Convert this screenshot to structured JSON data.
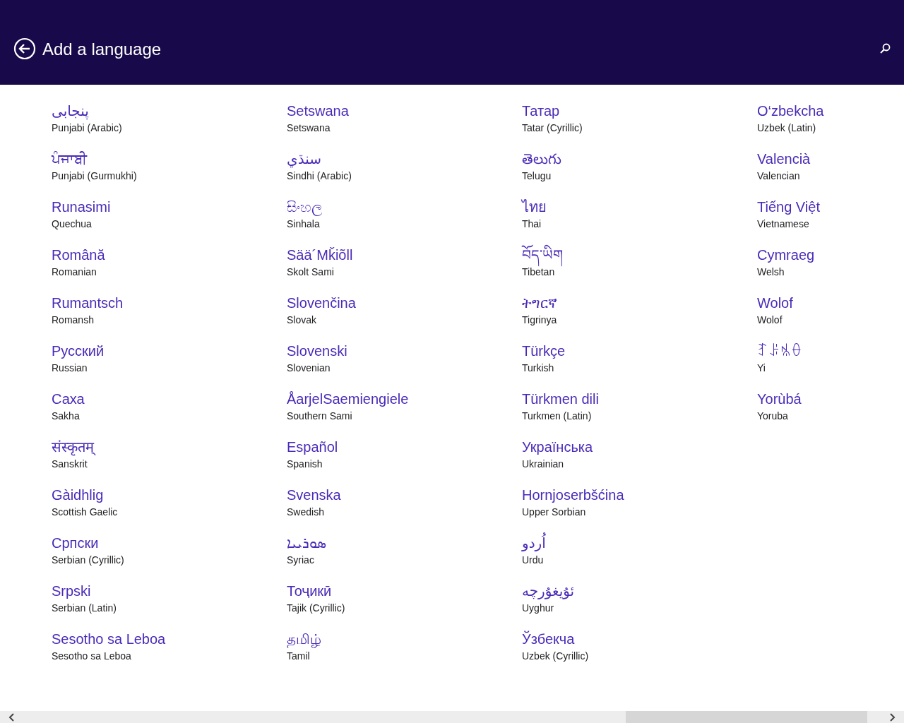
{
  "header": {
    "title": "Add a language"
  },
  "languages": [
    {
      "native": "پنجابی",
      "english": "Punjabi (Arabic)"
    },
    {
      "native": "ਪੰਜਾਬੀ",
      "english": "Punjabi (Gurmukhi)"
    },
    {
      "native": "Runasimi",
      "english": "Quechua"
    },
    {
      "native": "Română",
      "english": "Romanian"
    },
    {
      "native": "Rumantsch",
      "english": "Romansh"
    },
    {
      "native": "Русский",
      "english": "Russian"
    },
    {
      "native": "Саха",
      "english": "Sakha"
    },
    {
      "native": "संस्कृतम्",
      "english": "Sanskrit"
    },
    {
      "native": "Gàidhlig",
      "english": "Scottish Gaelic"
    },
    {
      "native": "Српски",
      "english": "Serbian (Cyrillic)"
    },
    {
      "native": "Srpski",
      "english": "Serbian (Latin)"
    },
    {
      "native": "Sesotho sa Leboa",
      "english": "Sesotho sa Leboa"
    },
    {
      "native": "Setswana",
      "english": "Setswana"
    },
    {
      "native": "سنڌي",
      "english": "Sindhi (Arabic)"
    },
    {
      "native": "සිංහල",
      "english": "Sinhala"
    },
    {
      "native": "Sää´Mǩiõll",
      "english": "Skolt Sami"
    },
    {
      "native": "Slovenčina",
      "english": "Slovak"
    },
    {
      "native": "Slovenski",
      "english": "Slovenian"
    },
    {
      "native": "ÅarjelSaemiengiele",
      "english": "Southern Sami"
    },
    {
      "native": "Español",
      "english": "Spanish"
    },
    {
      "native": "Svenska",
      "english": "Swedish"
    },
    {
      "native": "ܣܘܪܝܝܐ",
      "english": "Syriac"
    },
    {
      "native": "Тоҷикӣ",
      "english": "Tajik (Cyrillic)"
    },
    {
      "native": "தமிழ்",
      "english": "Tamil"
    },
    {
      "native": "Татар",
      "english": "Tatar (Cyrillic)"
    },
    {
      "native": "తెలుగు",
      "english": "Telugu"
    },
    {
      "native": "ไทย",
      "english": "Thai"
    },
    {
      "native": "བོད་ཡིག",
      "english": "Tibetan"
    },
    {
      "native": "ትግርኛ",
      "english": "Tigrinya"
    },
    {
      "native": "Türkçe",
      "english": "Turkish"
    },
    {
      "native": "Türkmen dili",
      "english": "Turkmen (Latin)"
    },
    {
      "native": "Українська",
      "english": "Ukrainian"
    },
    {
      "native": "Hornjoserbšćina",
      "english": "Upper Sorbian"
    },
    {
      "native": "اُردو",
      "english": "Urdu"
    },
    {
      "native": "ئۇيغۇرچە",
      "english": "Uyghur"
    },
    {
      "native": "Ўзбекча",
      "english": "Uzbek (Cyrillic)"
    },
    {
      "native": "O‘zbekcha",
      "english": "Uzbek (Latin)"
    },
    {
      "native": "Valencià",
      "english": "Valencian"
    },
    {
      "native": "Tiếng Việt",
      "english": "Vietnamese"
    },
    {
      "native": "Cymraeg",
      "english": "Welsh"
    },
    {
      "native": "Wolof",
      "english": "Wolof"
    },
    {
      "native": "ꆈꌠꁱꂷ",
      "english": "Yi"
    },
    {
      "native": "Yorùbá",
      "english": "Yoruba"
    }
  ]
}
